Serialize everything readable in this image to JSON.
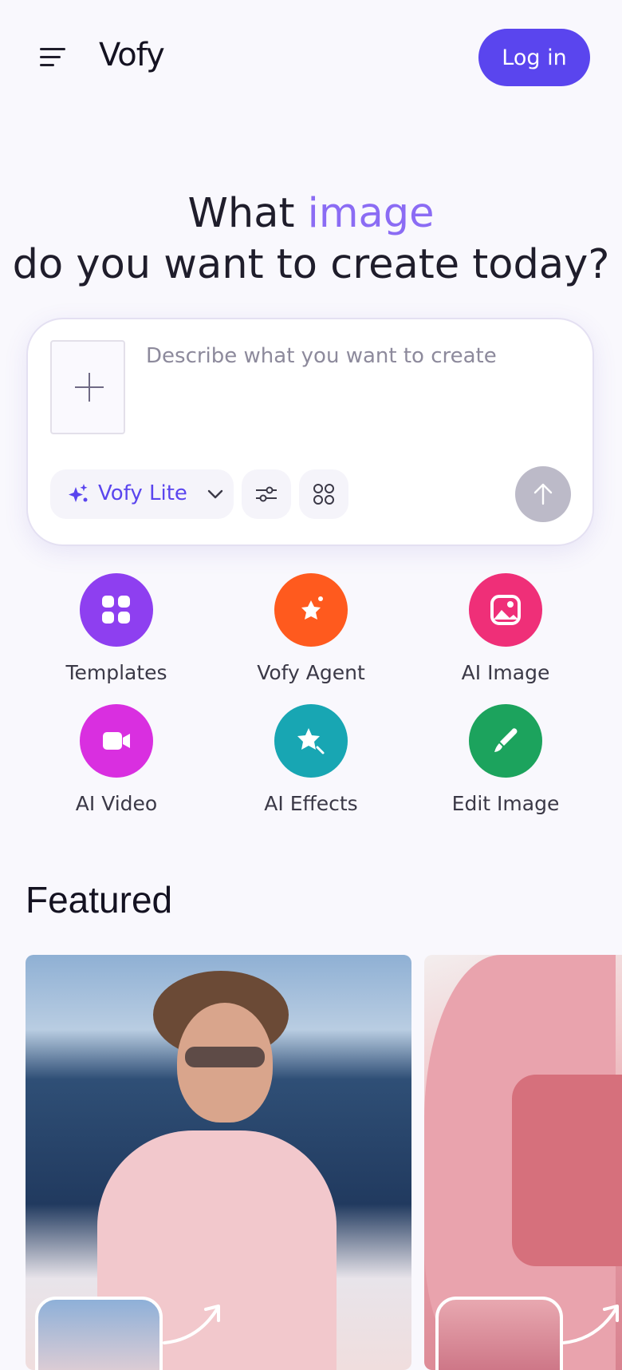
{
  "header": {
    "logo": "Vofy",
    "login_label": "Log in"
  },
  "hero": {
    "title_pre": "What ",
    "title_accent": "image",
    "title_post": " do you want to create today?"
  },
  "prompt": {
    "placeholder": "Describe what you want to create",
    "value": "",
    "model_label": "Vofy Lite"
  },
  "quick_actions": [
    {
      "label": "Templates",
      "icon": "grid-icon",
      "color": "#8e3ff0"
    },
    {
      "label": "Vofy Agent",
      "icon": "sparkle-star-icon",
      "color": "#ff5a1e"
    },
    {
      "label": "AI Image",
      "icon": "image-icon",
      "color": "#ef2f78"
    },
    {
      "label": "AI Video",
      "icon": "video-camera-icon",
      "color": "#d92fe0"
    },
    {
      "label": "AI Effects",
      "icon": "magic-star-icon",
      "color": "#18a6b3"
    },
    {
      "label": "Edit Image",
      "icon": "brush-icon",
      "color": "#1ca35d"
    }
  ],
  "featured": {
    "title": "Featured"
  },
  "colors": {
    "accent": "#5a45ee",
    "hero_accent": "#8b6cf4",
    "background": "#f9f8fd"
  }
}
